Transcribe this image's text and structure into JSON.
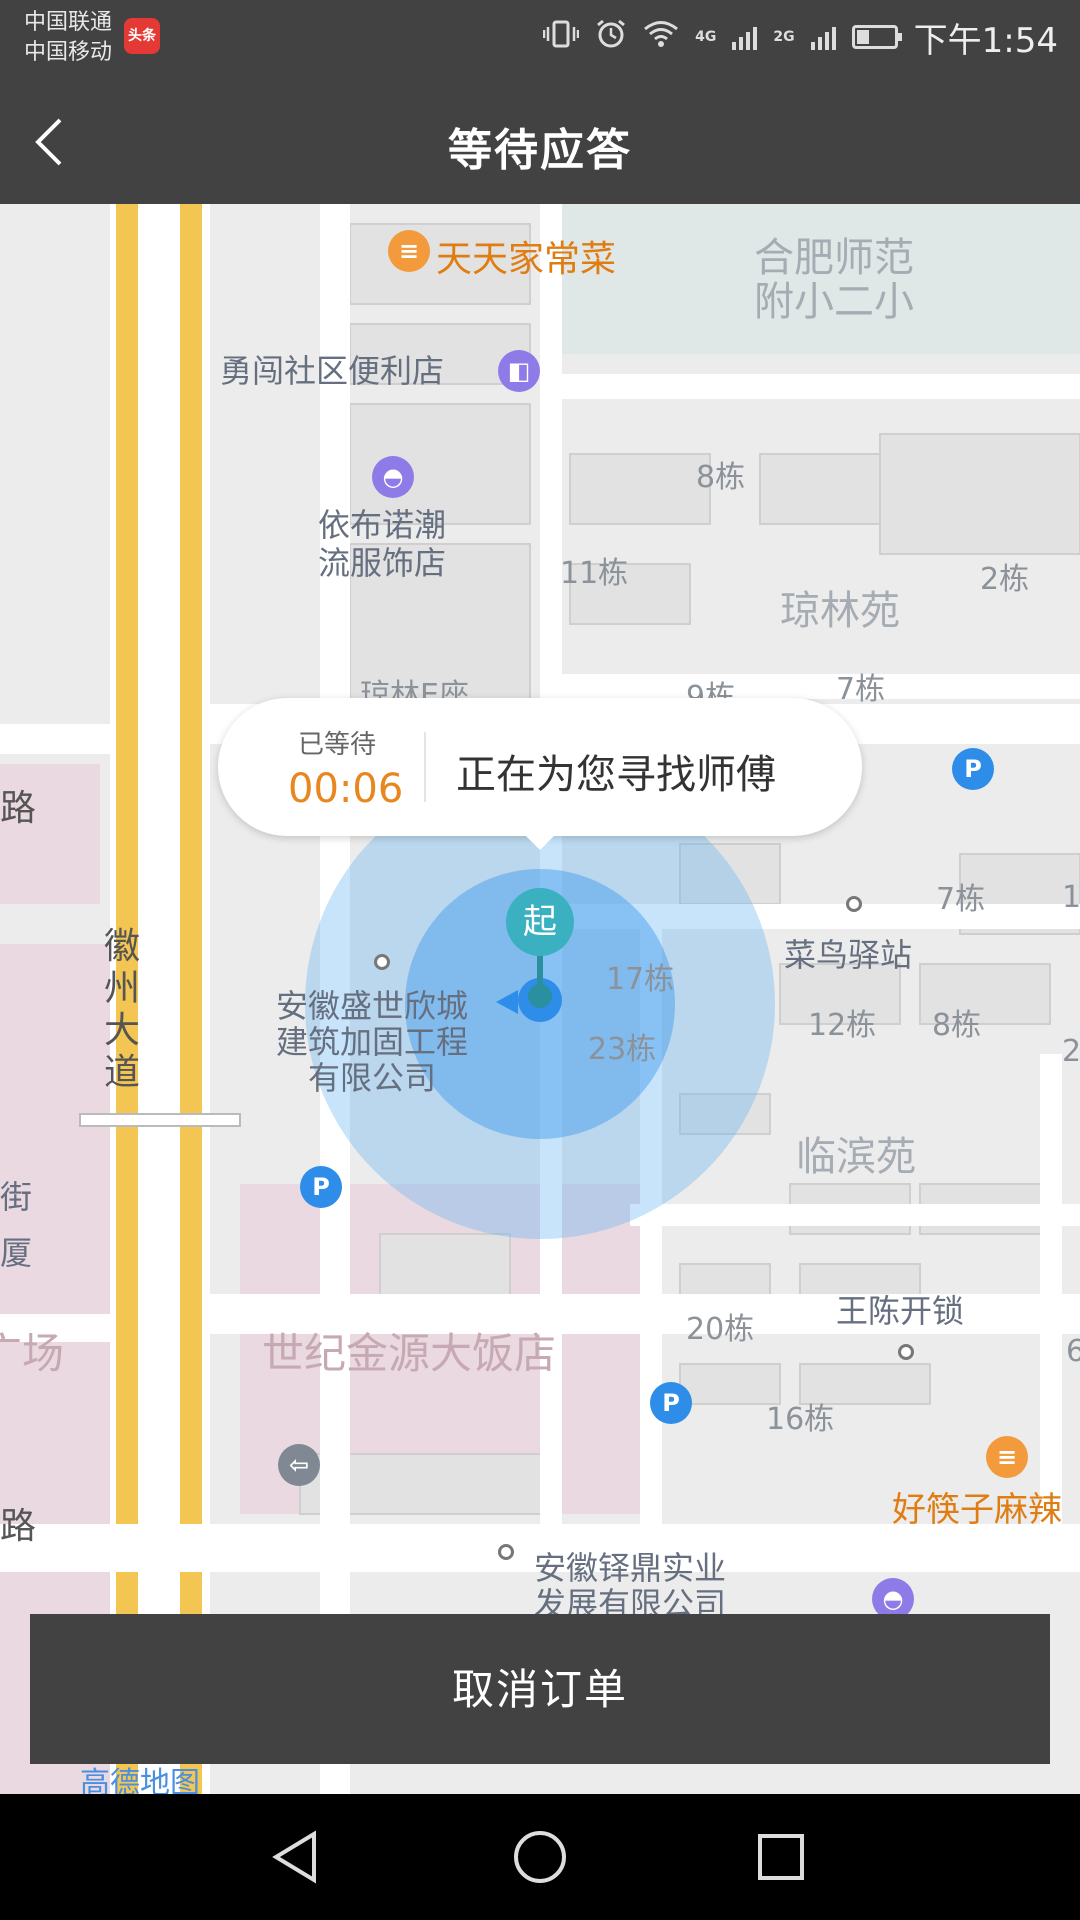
{
  "status_bar": {
    "carrier_1": "中国联通",
    "carrier_2": "中国移动",
    "badge": "头条",
    "net_1": "4G",
    "net_2": "2G",
    "time": "下午1:54"
  },
  "header": {
    "title": "等待应答"
  },
  "waiting": {
    "label": "已等待",
    "elapsed": "00:06",
    "status": "正在为您寻找师傅"
  },
  "start_marker": "起",
  "map_labels": {
    "tiantian": "天天家常菜",
    "hefei_school": "合肥师范\n附小二小",
    "yongchuang": "勇闯社区便利店",
    "yibunuo": "依布诺潮\n流服饰店",
    "b8": "8栋",
    "b11": "11栋",
    "qionglinyuan": "琼林苑",
    "b2": "2栋",
    "qionglin_e": "琼林E座",
    "b9": "9栋",
    "b7a": "7栋",
    "b7b": "7栋",
    "cainiao": "菜鸟驿站",
    "b17": "17栋",
    "b23": "23栋",
    "b12": "12栋",
    "b8b": "8栋",
    "anhui_shengshi": "安徽盛世欣城\n建筑加固工程\n有限公司",
    "linbinyuan": "临滨苑",
    "huizhou_road": "徽\n州\n大\n道",
    "lu": "路",
    "jie": "街",
    "sha": "厦",
    "chang": "广场",
    "shiji": "世纪金源大饭店",
    "b20": "20栋",
    "wangchen": "王陈开锁",
    "b16": "16栋",
    "haokuaizi": "好筷子麻辣",
    "anhui_yiding": "安徽铎鼎实业\n发展有限公司",
    "lu2": "路",
    "b1": "1",
    "b2b": "2",
    "b6": "6",
    "brand": "高德地图"
  },
  "cancel_button": "取消订单",
  "colors": {
    "bar_bg": "#424242",
    "accent_orange": "#e8861f",
    "location_blue": "#2e8de8",
    "start_pin": "#3bb0c0"
  }
}
